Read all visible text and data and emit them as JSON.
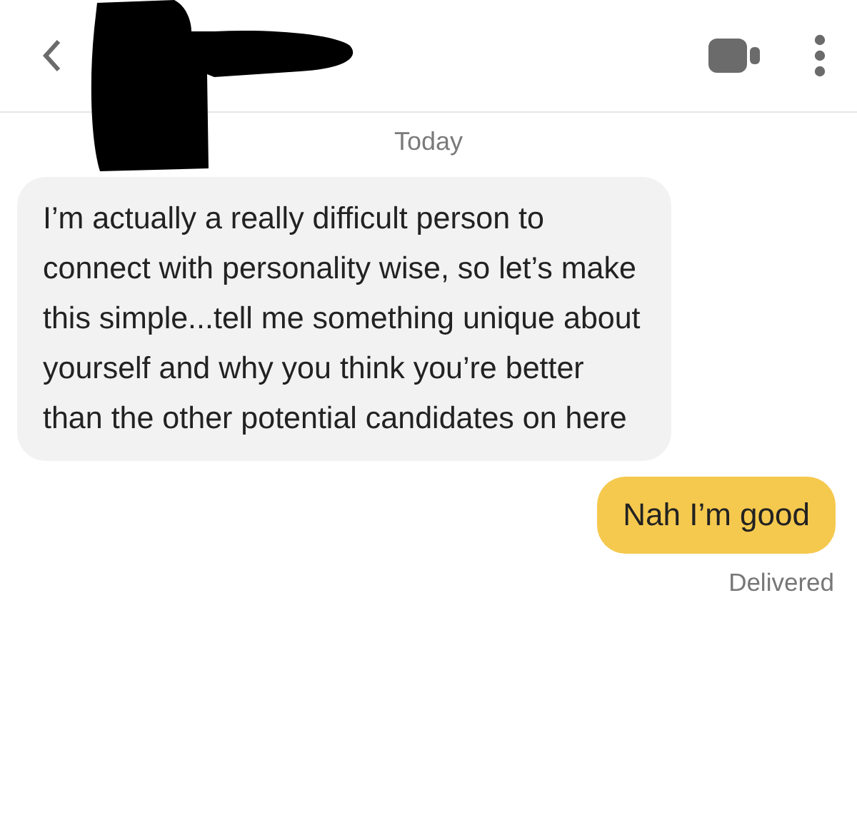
{
  "header": {
    "redacted": true
  },
  "date_divider": "Today",
  "messages": [
    {
      "kind": "incoming",
      "text": "I’m actually a really difficult person to connect with personality wise, so let’s make this simple...tell me something unique about yourself and why you think you’re better than the other potential candidates on here"
    },
    {
      "kind": "outgoing",
      "text": "Nah I’m good"
    }
  ],
  "status": "Delivered"
}
